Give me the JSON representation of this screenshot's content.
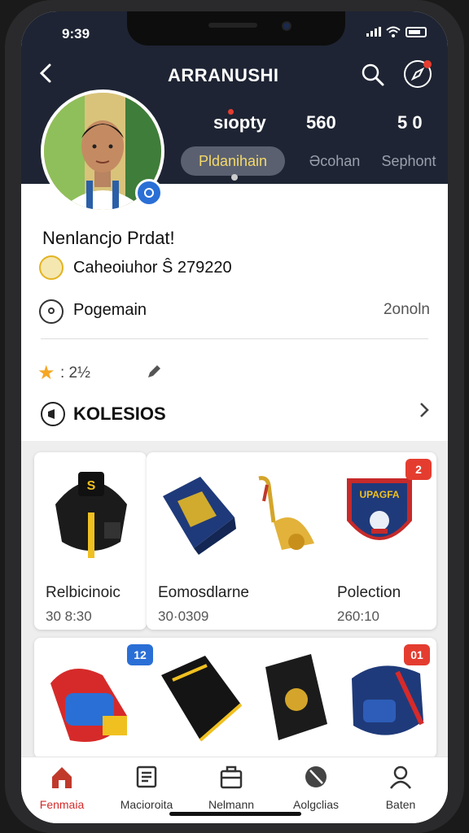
{
  "status_bar": {
    "time": "9:39"
  },
  "header": {
    "title": "ARRANUSHI",
    "stats": [
      "sıopty",
      "560",
      "5 0"
    ],
    "tabs": [
      "Pldanihain",
      "Əcohan",
      "Sephont"
    ]
  },
  "profile": {
    "name": "Nenlancjo Prdat!",
    "row1": "Caheoiuhor Ŝ 279220",
    "row2_label": "Pogemain",
    "row2_value": "2onoln",
    "rating": ": 2½",
    "section_title": "KOLESIOS"
  },
  "products": [
    {
      "label": "Relbicinoic",
      "sub": "30 8:30"
    },
    {
      "label": "Eomosdlarne",
      "sub": "30·0309"
    },
    {
      "label": "Polection",
      "sub": "260:10"
    }
  ],
  "badges": [
    "2",
    "12",
    "01"
  ],
  "nav": {
    "items": [
      "Fenmaia",
      "Macioroita",
      "Nelmann",
      "Aolgclias",
      "Baten"
    ]
  },
  "colors": {
    "header_bg": "#1e2433",
    "accent_red": "#e43d30",
    "accent_gold": "#f4d96a",
    "accent_blue": "#2a6fd6"
  }
}
